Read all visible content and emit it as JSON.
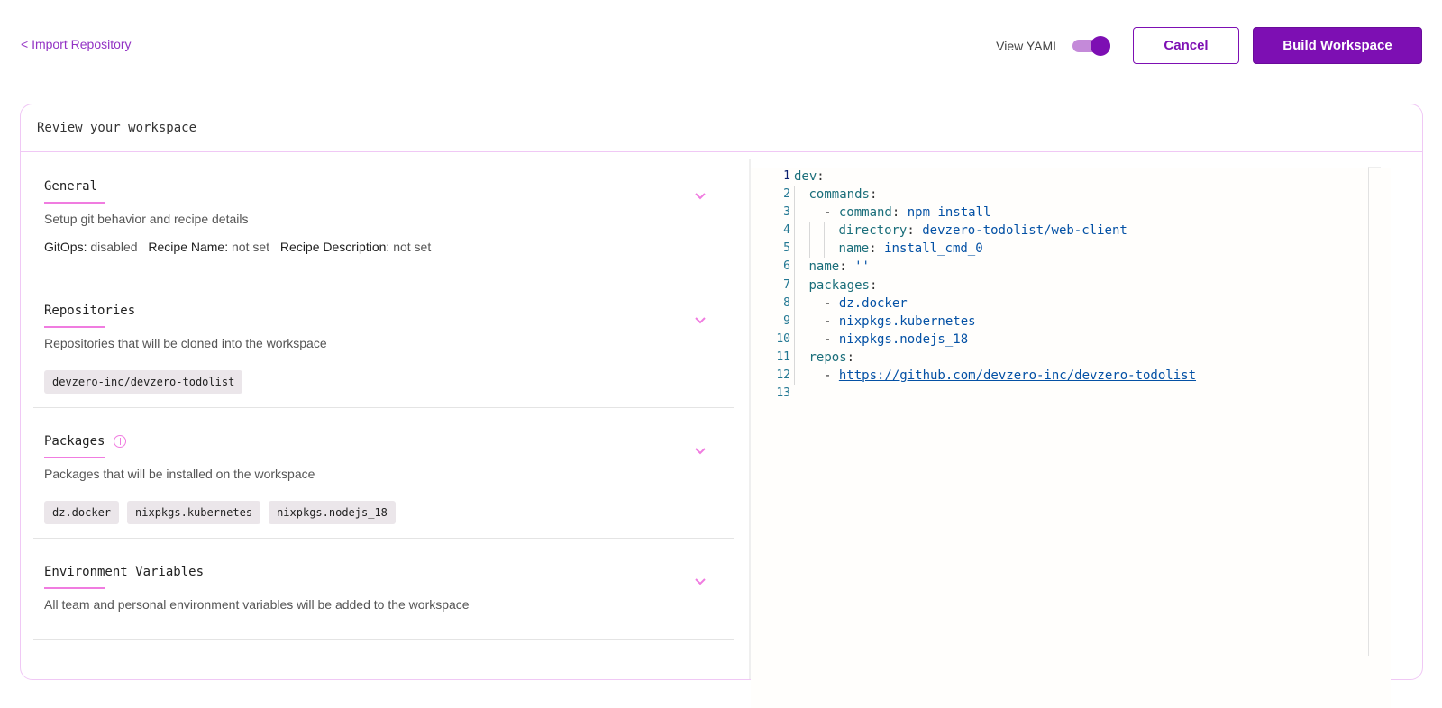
{
  "nav": {
    "back_label": "< Import Repository"
  },
  "header_actions": {
    "view_yaml_label": "View YAML",
    "view_yaml_enabled": true,
    "cancel_label": "Cancel",
    "build_label": "Build Workspace"
  },
  "colors": {
    "accent": "#7d0fb3",
    "accent_light": "#c48ad9",
    "highlight_pink": "#f07ce0",
    "card_border": "#f0c8f5"
  },
  "card": {
    "title": "Review your workspace"
  },
  "sections": {
    "general": {
      "title": "General",
      "description": "Setup git behavior and recipe details",
      "meta": [
        {
          "label": "GitOps:",
          "value": "disabled"
        },
        {
          "label": "Recipe Name:",
          "value": "not set"
        },
        {
          "label": "Recipe Description:",
          "value": "not set"
        }
      ]
    },
    "repositories": {
      "title": "Repositories",
      "description": "Repositories that will be cloned into the workspace",
      "items": [
        "devzero-inc/devzero-todolist"
      ]
    },
    "packages": {
      "title": "Packages",
      "description": "Packages that will be installed on the workspace",
      "items": [
        "dz.docker",
        "nixpkgs.kubernetes",
        "nixpkgs.nodejs_18"
      ]
    },
    "env": {
      "title": "Environment Variables",
      "description": "All team and personal environment variables will be added to the workspace"
    }
  },
  "yaml": {
    "lines": [
      {
        "n": "1",
        "indent": 0,
        "key": "dev",
        "value": ""
      },
      {
        "n": "2",
        "indent": 1,
        "key": "commands",
        "value": ""
      },
      {
        "n": "3",
        "indent": 2,
        "dash": true,
        "key": "command",
        "value": "npm install"
      },
      {
        "n": "4",
        "indent": 3,
        "key": "directory",
        "value": "devzero-todolist/web-client"
      },
      {
        "n": "5",
        "indent": 3,
        "key": "name",
        "value": "install_cmd_0"
      },
      {
        "n": "6",
        "indent": 1,
        "key": "name",
        "value": "''"
      },
      {
        "n": "7",
        "indent": 1,
        "key": "packages",
        "value": ""
      },
      {
        "n": "8",
        "indent": 2,
        "dash": true,
        "item": "dz.docker"
      },
      {
        "n": "9",
        "indent": 2,
        "dash": true,
        "item": "nixpkgs.kubernetes"
      },
      {
        "n": "10",
        "indent": 2,
        "dash": true,
        "item": "nixpkgs.nodejs_18"
      },
      {
        "n": "11",
        "indent": 1,
        "key": "repos",
        "value": ""
      },
      {
        "n": "12",
        "indent": 2,
        "dash": true,
        "item": "https://github.com/devzero-inc/devzero-todolist",
        "is_link": true
      },
      {
        "n": "13",
        "indent": 0,
        "empty": true
      }
    ]
  }
}
